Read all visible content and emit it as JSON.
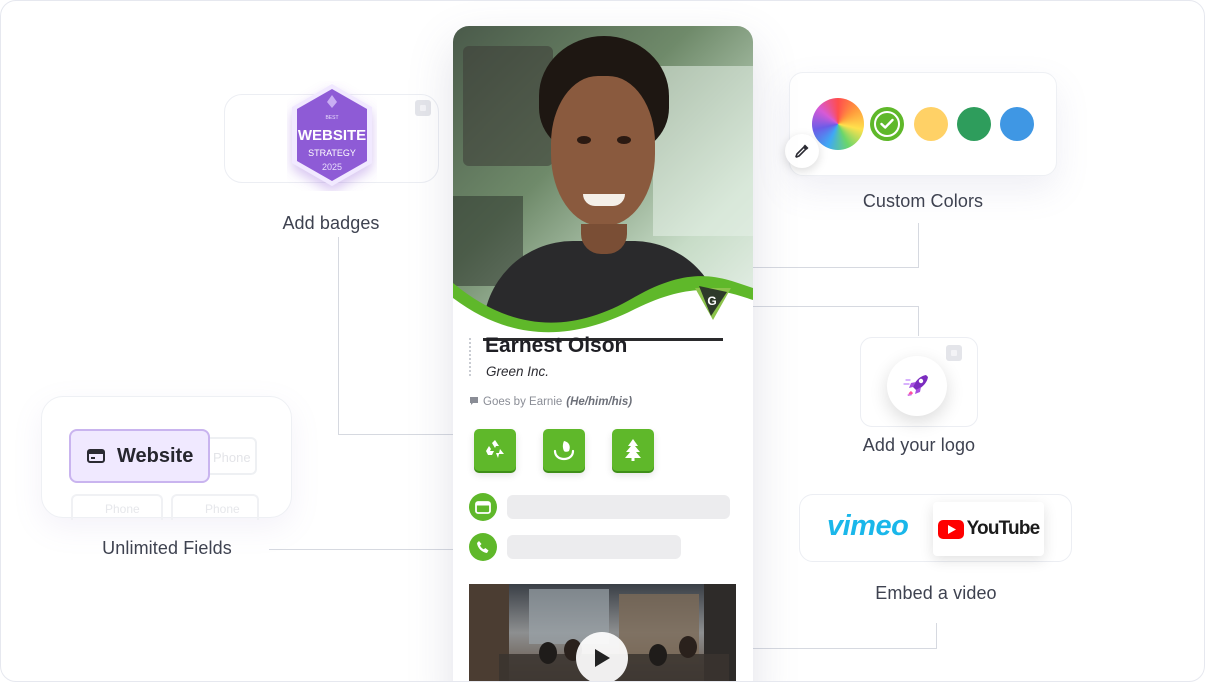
{
  "features": {
    "badges": {
      "caption": "Add badges"
    },
    "colors": {
      "caption": "Custom Colors",
      "swatches": [
        "#ffd166",
        "#2e9d5c",
        "#3f97e4"
      ],
      "selected": "#5fb82a"
    },
    "logo": {
      "caption": "Add your logo"
    },
    "fields": {
      "caption": "Unlimited Fields",
      "button_label": "Website",
      "ghost_labels": [
        "Phone",
        "Phone",
        "Phone"
      ]
    },
    "video": {
      "caption": "Embed a video",
      "vimeo_label": "vimeo",
      "youtube_label": "YouTube"
    }
  },
  "badge": {
    "line1": "BEST",
    "line2": "WEBSITE",
    "line3": "STRATEGY",
    "line4": "2025",
    "color": "#8e5bd6"
  },
  "card": {
    "name": "Earnest Olson",
    "company": "Green Inc.",
    "goes_by_label": "Goes by Earnie",
    "pronouns": "(He/him/his)",
    "logo_letter": "G",
    "accent": "#5fb82a",
    "eco_icons": [
      "recycle-icon",
      "leaf-hands-icon",
      "tree-icon"
    ],
    "fields": [
      "website-icon",
      "phone-icon"
    ]
  }
}
